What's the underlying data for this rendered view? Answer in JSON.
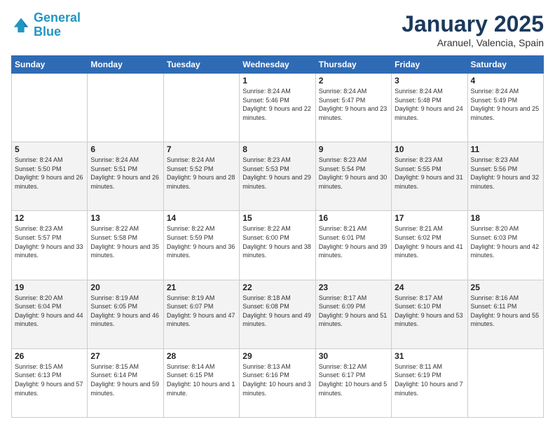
{
  "logo": {
    "line1": "General",
    "line2": "Blue"
  },
  "header": {
    "title": "January 2025",
    "location": "Aranuel, Valencia, Spain"
  },
  "weekdays": [
    "Sunday",
    "Monday",
    "Tuesday",
    "Wednesday",
    "Thursday",
    "Friday",
    "Saturday"
  ],
  "weeks": [
    [
      {
        "day": "",
        "info": ""
      },
      {
        "day": "",
        "info": ""
      },
      {
        "day": "",
        "info": ""
      },
      {
        "day": "1",
        "info": "Sunrise: 8:24 AM\nSunset: 5:46 PM\nDaylight: 9 hours\nand 22 minutes."
      },
      {
        "day": "2",
        "info": "Sunrise: 8:24 AM\nSunset: 5:47 PM\nDaylight: 9 hours\nand 23 minutes."
      },
      {
        "day": "3",
        "info": "Sunrise: 8:24 AM\nSunset: 5:48 PM\nDaylight: 9 hours\nand 24 minutes."
      },
      {
        "day": "4",
        "info": "Sunrise: 8:24 AM\nSunset: 5:49 PM\nDaylight: 9 hours\nand 25 minutes."
      }
    ],
    [
      {
        "day": "5",
        "info": "Sunrise: 8:24 AM\nSunset: 5:50 PM\nDaylight: 9 hours\nand 26 minutes."
      },
      {
        "day": "6",
        "info": "Sunrise: 8:24 AM\nSunset: 5:51 PM\nDaylight: 9 hours\nand 26 minutes."
      },
      {
        "day": "7",
        "info": "Sunrise: 8:24 AM\nSunset: 5:52 PM\nDaylight: 9 hours\nand 28 minutes."
      },
      {
        "day": "8",
        "info": "Sunrise: 8:23 AM\nSunset: 5:53 PM\nDaylight: 9 hours\nand 29 minutes."
      },
      {
        "day": "9",
        "info": "Sunrise: 8:23 AM\nSunset: 5:54 PM\nDaylight: 9 hours\nand 30 minutes."
      },
      {
        "day": "10",
        "info": "Sunrise: 8:23 AM\nSunset: 5:55 PM\nDaylight: 9 hours\nand 31 minutes."
      },
      {
        "day": "11",
        "info": "Sunrise: 8:23 AM\nSunset: 5:56 PM\nDaylight: 9 hours\nand 32 minutes."
      }
    ],
    [
      {
        "day": "12",
        "info": "Sunrise: 8:23 AM\nSunset: 5:57 PM\nDaylight: 9 hours\nand 33 minutes."
      },
      {
        "day": "13",
        "info": "Sunrise: 8:22 AM\nSunset: 5:58 PM\nDaylight: 9 hours\nand 35 minutes."
      },
      {
        "day": "14",
        "info": "Sunrise: 8:22 AM\nSunset: 5:59 PM\nDaylight: 9 hours\nand 36 minutes."
      },
      {
        "day": "15",
        "info": "Sunrise: 8:22 AM\nSunset: 6:00 PM\nDaylight: 9 hours\nand 38 minutes."
      },
      {
        "day": "16",
        "info": "Sunrise: 8:21 AM\nSunset: 6:01 PM\nDaylight: 9 hours\nand 39 minutes."
      },
      {
        "day": "17",
        "info": "Sunrise: 8:21 AM\nSunset: 6:02 PM\nDaylight: 9 hours\nand 41 minutes."
      },
      {
        "day": "18",
        "info": "Sunrise: 8:20 AM\nSunset: 6:03 PM\nDaylight: 9 hours\nand 42 minutes."
      }
    ],
    [
      {
        "day": "19",
        "info": "Sunrise: 8:20 AM\nSunset: 6:04 PM\nDaylight: 9 hours\nand 44 minutes."
      },
      {
        "day": "20",
        "info": "Sunrise: 8:19 AM\nSunset: 6:05 PM\nDaylight: 9 hours\nand 46 minutes."
      },
      {
        "day": "21",
        "info": "Sunrise: 8:19 AM\nSunset: 6:07 PM\nDaylight: 9 hours\nand 47 minutes."
      },
      {
        "day": "22",
        "info": "Sunrise: 8:18 AM\nSunset: 6:08 PM\nDaylight: 9 hours\nand 49 minutes."
      },
      {
        "day": "23",
        "info": "Sunrise: 8:17 AM\nSunset: 6:09 PM\nDaylight: 9 hours\nand 51 minutes."
      },
      {
        "day": "24",
        "info": "Sunrise: 8:17 AM\nSunset: 6:10 PM\nDaylight: 9 hours\nand 53 minutes."
      },
      {
        "day": "25",
        "info": "Sunrise: 8:16 AM\nSunset: 6:11 PM\nDaylight: 9 hours\nand 55 minutes."
      }
    ],
    [
      {
        "day": "26",
        "info": "Sunrise: 8:15 AM\nSunset: 6:13 PM\nDaylight: 9 hours\nand 57 minutes."
      },
      {
        "day": "27",
        "info": "Sunrise: 8:15 AM\nSunset: 6:14 PM\nDaylight: 9 hours\nand 59 minutes."
      },
      {
        "day": "28",
        "info": "Sunrise: 8:14 AM\nSunset: 6:15 PM\nDaylight: 10 hours\nand 1 minute."
      },
      {
        "day": "29",
        "info": "Sunrise: 8:13 AM\nSunset: 6:16 PM\nDaylight: 10 hours\nand 3 minutes."
      },
      {
        "day": "30",
        "info": "Sunrise: 8:12 AM\nSunset: 6:17 PM\nDaylight: 10 hours\nand 5 minutes."
      },
      {
        "day": "31",
        "info": "Sunrise: 8:11 AM\nSunset: 6:19 PM\nDaylight: 10 hours\nand 7 minutes."
      },
      {
        "day": "",
        "info": ""
      }
    ]
  ]
}
